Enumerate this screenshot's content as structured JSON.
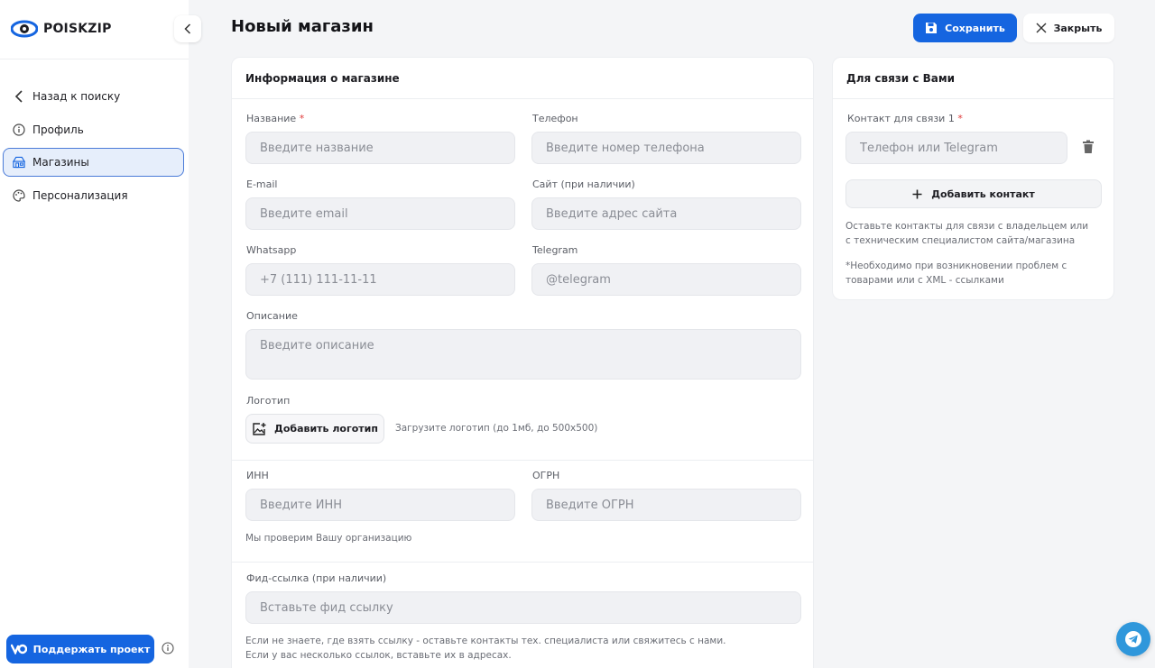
{
  "app": {
    "logo_text": "POISKZIP",
    "page_title": "Новый магазин"
  },
  "sidebar": {
    "items": [
      {
        "label": "Назад к поиску",
        "icon": "chevron-left-icon"
      },
      {
        "label": "Профиль",
        "icon": "info-icon"
      },
      {
        "label": "Магазины",
        "icon": "store-icon",
        "active": true
      },
      {
        "label": "Персонализация",
        "icon": "palette-icon"
      }
    ],
    "support_label": "Поддержать проект"
  },
  "header": {
    "save_label": "Сохранить",
    "close_label": "Закрыть"
  },
  "store_info": {
    "title": "Информация о магазине",
    "name_label": "Название",
    "required_mark": "*",
    "name_placeholder": "Введите название",
    "phone_label": "Телефон",
    "phone_placeholder": "Введите номер телефона",
    "email_label": "E-mail",
    "email_placeholder": "Введите email",
    "site_label": "Сайт (при наличии)",
    "site_placeholder": "Введите адрес сайта",
    "whatsapp_label": "Whatsapp",
    "whatsapp_placeholder": "+7 (111) 111-11-11",
    "telegram_label": "Telegram",
    "telegram_placeholder": "@telegram",
    "description_label": "Описание",
    "description_placeholder": "Введите описание",
    "logo_label": "Логотип",
    "logo_button": "Добавить логотип",
    "logo_hint": "Загрузите логотип (до 1мб, до 500x500)",
    "inn_label": "ИНН",
    "inn_placeholder": "Введите ИНН",
    "ogrn_label": "ОГРН",
    "ogrn_placeholder": "Введите ОГРН",
    "org_hint": "Мы проверим Вашу организацию",
    "feed_label": "Фид-ссылка (при наличии)",
    "feed_placeholder": "Вставьте фид ссылку",
    "feed_hint_1": "Если не знаете, где взять ссылку - оставьте контакты тех. специалиста или свяжитесь с нами.",
    "feed_hint_2": "Если у вас несколько ссылок, вставьте их в адресах."
  },
  "contact": {
    "title": "Для связи с Вами",
    "contact_label": "Контакт для связи 1",
    "required_mark": "*",
    "contact_placeholder": "Телефон или Telegram",
    "add_contact": "Добавить контакт",
    "hint_1": "Оставьте контакты для связи с владельцем или с техническим специалистом сайта/магазина",
    "hint_2": "*Необходимо при возникновении проблем с товарами или с XML - ссылками"
  },
  "colors": {
    "accent": "#1565e0",
    "active_nav_bg": "#e6eefb",
    "required": "#e03a3a",
    "telegram": "#2f97db"
  }
}
